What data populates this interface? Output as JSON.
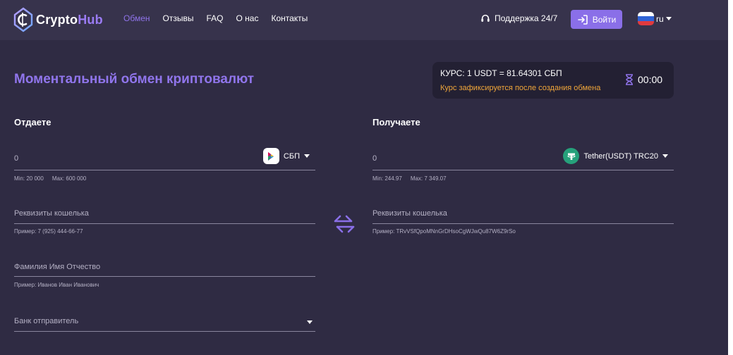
{
  "header": {
    "logo": {
      "text_main": "Crypto",
      "text_accent": "Hub"
    },
    "nav": [
      {
        "label": "Обмен",
        "active": true
      },
      {
        "label": "Отзывы",
        "active": false
      },
      {
        "label": "FAQ",
        "active": false
      },
      {
        "label": "О нас",
        "active": false
      },
      {
        "label": "Контакты",
        "active": false
      }
    ],
    "support_label": "Поддержка 24/7",
    "support_icon": "headset-icon",
    "login_label": "Войти",
    "login_icon": "login-icon",
    "language": "ru",
    "flag_icon": "russia-flag-icon"
  },
  "main": {
    "title": "Моментальный обмен криптовалют",
    "rate": {
      "text": "КУРС: 1 USDT = 81.64301 СБП",
      "note": "Курс зафиксируется после создания обмена",
      "timer": "00:00",
      "timer_icon": "hourglass-icon"
    },
    "give": {
      "title": "Отдаете",
      "amount": "0",
      "currency": "СБП",
      "currency_icon": "sbp-icon",
      "min": "Min: 20 000",
      "max": "Max: 600 000",
      "fields": [
        {
          "placeholder": "Реквизиты кошелька",
          "hint": "Пример: 7 (925) 444-66-77"
        },
        {
          "placeholder": "Фамилия Имя Отчество",
          "hint": "Пример: Иванов Иван Иванович"
        }
      ],
      "bank_placeholder": "Банк отправитель"
    },
    "receive": {
      "title": "Получаете",
      "amount": "0",
      "currency": "Tether(USDT) TRC20",
      "currency_icon": "tether-icon",
      "min": "Min: 244.97",
      "max": "Max: 7 349.07",
      "fields": [
        {
          "placeholder": "Реквизиты кошелька",
          "hint": "Пример: TRvVSfQpoMNnGrDHsoCgWJwQu87W6Z9rSo"
        }
      ]
    },
    "swap_icon": "swap-arrows-icon"
  },
  "colors": {
    "background": "#2f2b43",
    "header": "#37334c",
    "accent": "#8a6fe8",
    "warning": "#f0a63a",
    "tether": "#26a17b"
  }
}
